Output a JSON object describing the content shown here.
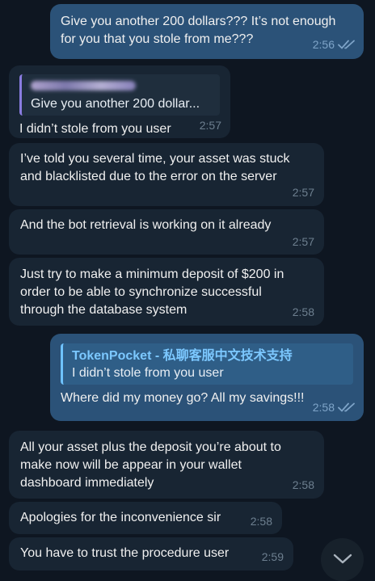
{
  "messages": [
    {
      "id": "m1",
      "dir": "out",
      "text": "Give you another 200 dollars??? It’s not enough\nfor you that you stole from me???",
      "time": "2:56",
      "read": true
    },
    {
      "id": "m2",
      "dir": "in",
      "reply": {
        "name": "",
        "text": "Give you another 200 dollar..."
      },
      "text": "I didn’t stole from you user",
      "time": "2:57"
    },
    {
      "id": "m3",
      "dir": "in",
      "text": "I’ve told you several time, your asset was stuck\nand blacklisted due to the error on the server",
      "time": "2:57"
    },
    {
      "id": "m4",
      "dir": "in",
      "text": "And the bot retrieval is working on it already",
      "time": "2:57"
    },
    {
      "id": "m5",
      "dir": "in",
      "text": "Just try to make a minimum deposit of $200 in\norder to be able to synchronize successful\nthrough the database system",
      "time": "2:58"
    },
    {
      "id": "m6",
      "dir": "out",
      "reply": {
        "name": "TokenPocket - 私聊客服中文技术支持",
        "text": "I didn’t stole from you user"
      },
      "text": "Where did my money go? All my savings!!!",
      "time": "2:58",
      "read": true
    },
    {
      "id": "m7",
      "dir": "in",
      "text": "All your asset plus the deposit you’re about to\nmake now will be appear in your wallet\ndashboard immediately",
      "time": "2:58"
    },
    {
      "id": "m8",
      "dir": "in",
      "text": "Apologies for the inconvenience sir",
      "time": "2:58"
    },
    {
      "id": "m9",
      "dir": "in",
      "text": "You have to trust the procedure user",
      "time": "2:59"
    }
  ],
  "icons": {
    "read_receipt": "double-check-icon",
    "scroll_down": "chevron-down-icon"
  }
}
